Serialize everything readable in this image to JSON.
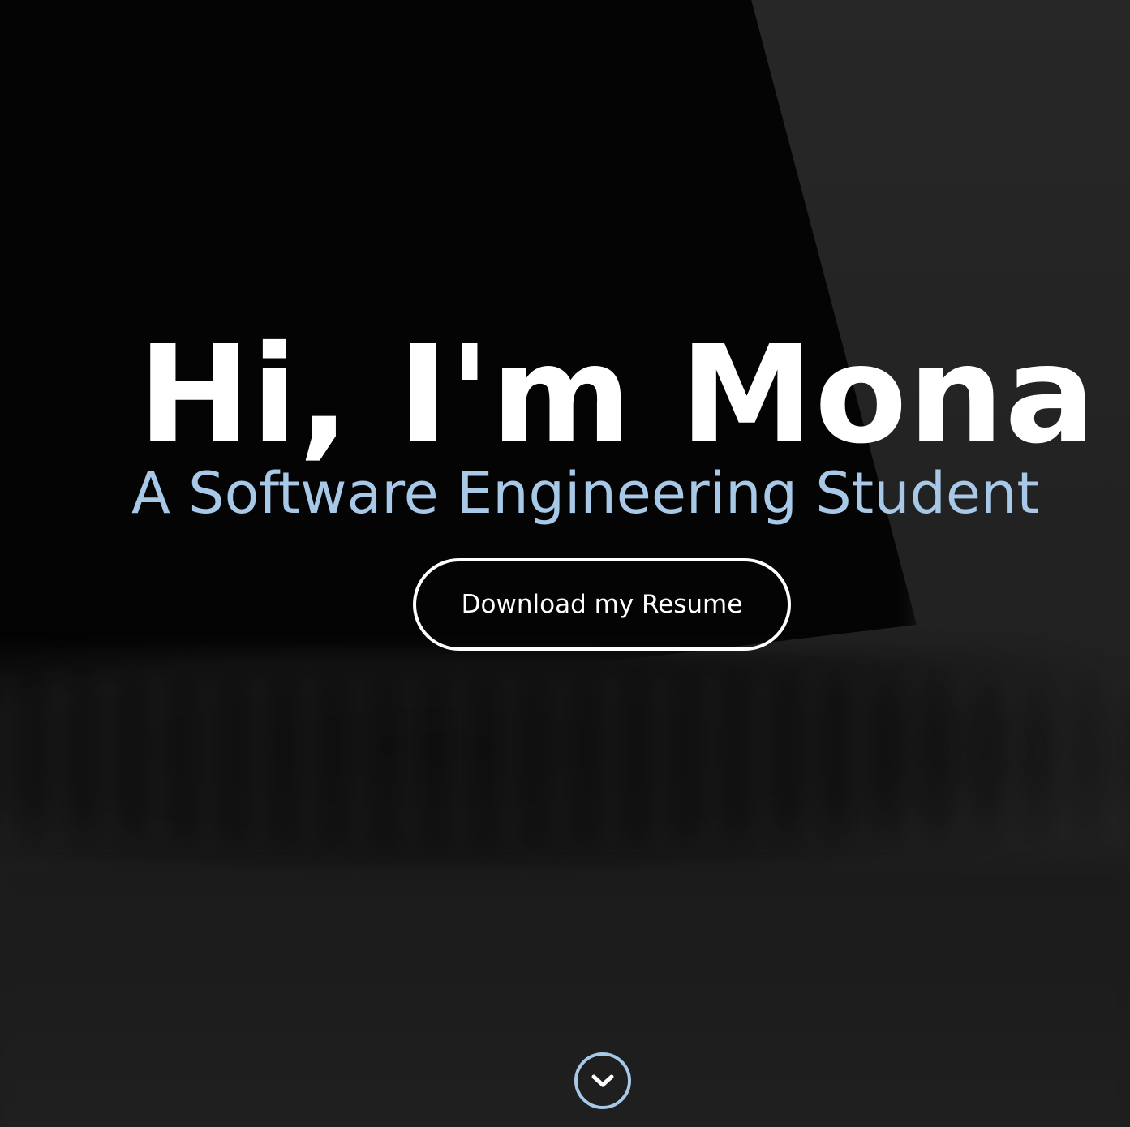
{
  "hero": {
    "greeting": "Hi, I'm Mona",
    "tagline": "A Software Engineering Student",
    "resume_button_label": "Download my Resume",
    "scroll_icon": "chevron-down-icon"
  },
  "colors": {
    "heading": "#ffffff",
    "accent": "#a8c8e8",
    "background": "#1a1a1a"
  }
}
